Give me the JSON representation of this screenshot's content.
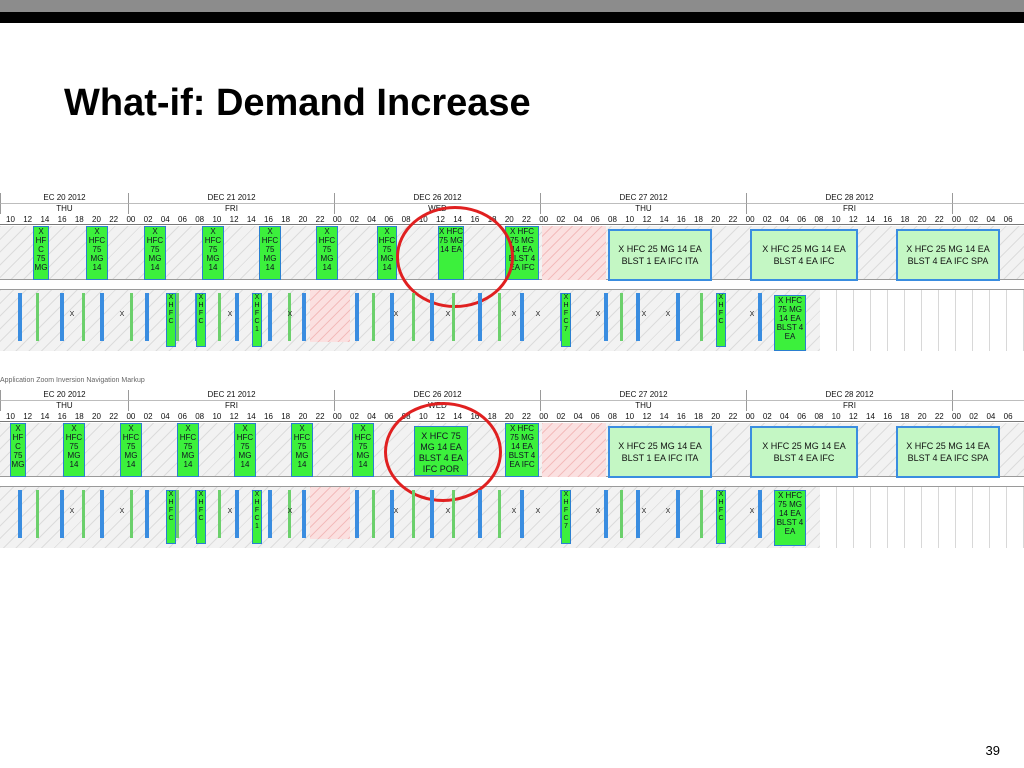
{
  "slide": {
    "title": "What-if: Demand Increase",
    "page_number": "39"
  },
  "colors": {
    "task_green": "#3cf03c",
    "task_wide_bg": "#c4f7c4",
    "task_border": "#3a8de0",
    "circle_red": "#e02020",
    "maintenance_pink": "#f3bcbc"
  },
  "timeline": {
    "dates": [
      {
        "label": "EC 20 2012",
        "day": "THU"
      },
      {
        "label": "DEC 21 2012",
        "day": "FRI"
      },
      {
        "label": "DEC 26 2012",
        "day": "WED"
      },
      {
        "label": "DEC 27 2012",
        "day": "THU"
      },
      {
        "label": "DEC 28 2012",
        "day": "FRI"
      }
    ],
    "hours_first": [
      "10",
      "12",
      "14",
      "16",
      "18",
      "20",
      "22"
    ],
    "hours_day": [
      "00",
      "02",
      "04",
      "06",
      "08",
      "10",
      "12",
      "14",
      "16",
      "18",
      "20",
      "22"
    ],
    "hours_tail": [
      "00",
      "02",
      "04",
      "06"
    ]
  },
  "top_chart": {
    "narrow_tasks": [
      "X HF C 75 MG",
      "X HFC 75 MG 14",
      "X HFC 75 MG 14",
      "X HFC 75 MG 14",
      "X HFC 75 MG 14",
      "X HFC 75 MG 14",
      "X HFC 75 MG 14",
      "X HFC 75 MG 14 EA",
      "X HFC 75 MG 14 EA BLST 4 EA IFC"
    ],
    "wide_tasks": [
      "X HFC 25 MG 14 EA BLST 1 EA IFC ITA",
      "X HFC 25 MG 14 EA BLST 4 EA IFC",
      "X HFC 25 MG 14 EA BLST 4 EA IFC SPA"
    ],
    "lower_task": "X HFC 75 MG 14 EA BLST 4 EA"
  },
  "bottom_chart": {
    "narrow_tasks": [
      "X HF C 75 MG",
      "X HFC 75 MG 14",
      "X HFC 75 MG 14",
      "X HFC 75 MG 14",
      "X HFC 75 MG 14",
      "X HFC 75 MG 14",
      "X HFC 75 MG 14",
      "X HFC 75 MG 14 EA BLST 4 EA IFC"
    ],
    "merged_task": "X HFC 75 MG 14 EA BLST 4 EA IFC POR",
    "wide_tasks": [
      "X HFC 25 MG 14 EA BLST 1 EA IFC ITA",
      "X HFC 25 MG 14 EA BLST 4 EA IFC",
      "X HFC 25 MG 14 EA BLST 4 EA IFC SPA"
    ],
    "lower_task": "X HFC 75 MG 14 EA BLST 4 EA"
  },
  "mini_labels": [
    "X",
    "X",
    "X",
    "X",
    "X",
    "X",
    "X",
    "X",
    "X",
    "X",
    "X",
    "X"
  ],
  "mini_tasks": [
    "XHFC",
    "XHFC",
    "XHFC1",
    "XHFC7",
    "XHFC"
  ],
  "toolbar_strip": "Application    Zoom    Inversion    Navigation    Markup"
}
